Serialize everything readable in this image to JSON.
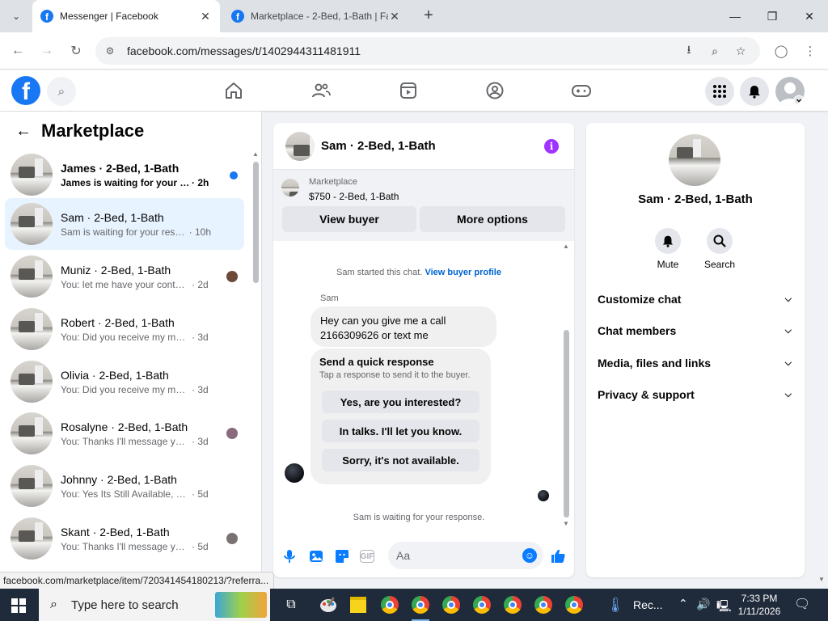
{
  "browser": {
    "tabs": [
      {
        "title": "Messenger | Facebook",
        "active": true
      },
      {
        "title": "Marketplace - 2-Bed, 1-Bath | Fa",
        "active": false
      }
    ],
    "url": "facebook.com/messages/t/1402944311481911"
  },
  "fbnav": {
    "logo": "f",
    "icons": [
      "home-icon",
      "friends-icon",
      "watch-icon",
      "groups-icon",
      "gaming-icon"
    ]
  },
  "left": {
    "title": "Marketplace",
    "conversations": [
      {
        "name": "James · 2-Bed, 1-Bath",
        "preview": "James is waiting for your respo...",
        "time": "· 2h",
        "unread": true,
        "indicator": "dot"
      },
      {
        "name": "Sam · 2-Bed, 1-Bath",
        "preview": "Sam is waiting for your response.",
        "time": "· 10h",
        "unread": false,
        "selected": true
      },
      {
        "name": "Muniz · 2-Bed, 1-Bath",
        "preview": "You: let me have your contact n...",
        "time": "· 2d",
        "indicator": "avatar"
      },
      {
        "name": "Robert · 2-Bed, 1-Bath",
        "preview": "You: Did you receive my message",
        "time": "· 3d"
      },
      {
        "name": "Olivia · 2-Bed, 1-Bath",
        "preview": "You: Did you receive my message",
        "time": "· 3d"
      },
      {
        "name": "Rosalyne · 2-Bed, 1-Bath",
        "preview": "You: Thanks I'll message you in ...",
        "time": "· 3d",
        "indicator": "avatar"
      },
      {
        "name": "Johnny · 2-Bed, 1-Bath",
        "preview": "You: Yes Its Still Available, Please Se...",
        "time": "· 5d"
      },
      {
        "name": "Skant · 2-Bed, 1-Bath",
        "preview": "You: Thanks I'll message you in ...",
        "time": "· 5d",
        "indicator": "avatar"
      }
    ]
  },
  "chat": {
    "title": "Sam · 2-Bed, 1-Bath",
    "listing_category": "Marketplace",
    "listing_price": "$750 - 2-Bed, 1-Bath",
    "view_buyer": "View buyer",
    "more_options": "More options",
    "started_text": "Sam started this chat.",
    "view_buyer_profile": "View buyer profile",
    "sender": "Sam",
    "message": "Hey can you give me a call 2166309626 or text me",
    "quick_title": "Send a quick response",
    "quick_sub": "Tap a response to send it to the buyer.",
    "quick_options": [
      "Yes, are you interested?",
      "In talks. I'll let you know.",
      "Sorry, it's not available."
    ],
    "waiting": "Sam is waiting for your response.",
    "composer_placeholder": "Aa"
  },
  "right": {
    "name": "Sam · 2-Bed, 1-Bath",
    "mute": "Mute",
    "search": "Search",
    "sections": [
      "Customize chat",
      "Chat members",
      "Media, files and links",
      "Privacy & support"
    ]
  },
  "status_url": "facebook.com/marketplace/item/720341454180213/?referra...",
  "taskbar": {
    "search_placeholder": "Type here to search",
    "rec_label": "Rec...",
    "time": "7:33 PM",
    "date": "1/11/2026"
  },
  "colors": {
    "fb_blue": "#1877f2",
    "messenger_blue": "#0a7cff",
    "selected_row": "#e7f3ff",
    "info_purple": "#a033ff"
  }
}
